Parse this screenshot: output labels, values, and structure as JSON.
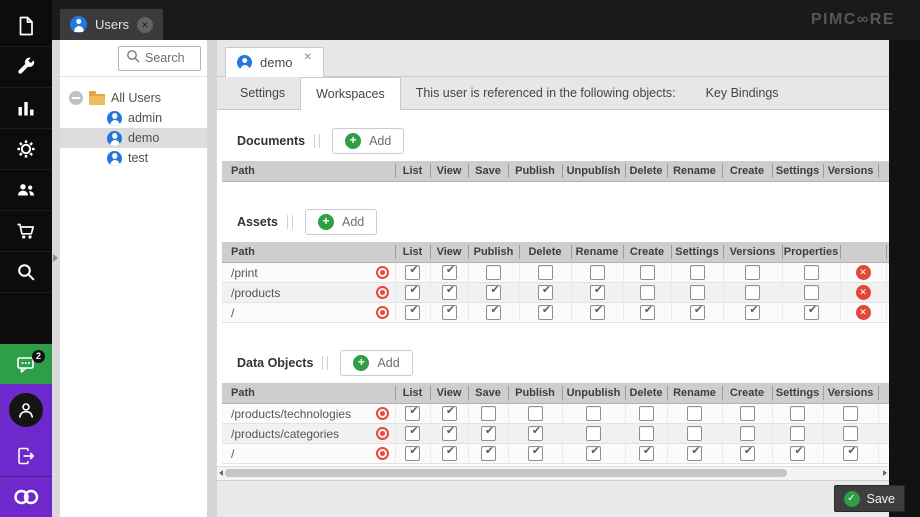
{
  "topbar": {
    "logo_text": "PIMC∞RE",
    "open_tab_label": "Users"
  },
  "sidebar": {
    "top_items": [
      {
        "name": "document-icon"
      },
      {
        "name": "wrench-icon"
      },
      {
        "name": "bar-chart-icon"
      },
      {
        "name": "gear-icon"
      },
      {
        "name": "users-icon"
      },
      {
        "name": "cart-icon"
      },
      {
        "name": "search-icon"
      }
    ],
    "chat_badge": "2"
  },
  "tree": {
    "search_placeholder": "Search",
    "root_label": "All Users",
    "items": [
      "admin",
      "demo",
      "test"
    ],
    "selected": "demo"
  },
  "editor": {
    "tab_label": "demo",
    "nav_tabs": [
      {
        "label": "Settings",
        "active": false
      },
      {
        "label": "Workspaces",
        "active": true
      },
      {
        "label": "This user is referenced in the following objects:",
        "active": false
      },
      {
        "label": "Key Bindings",
        "active": false
      }
    ],
    "sections": [
      {
        "id": "documents",
        "title": "Documents",
        "add_label": "Add",
        "columns": [
          "Path",
          "List",
          "View",
          "Save",
          "Publish",
          "Unpublish",
          "Delete",
          "Rename",
          "Create",
          "Settings",
          "Versions"
        ],
        "has_delete_column": false,
        "rows": []
      },
      {
        "id": "assets",
        "title": "Assets",
        "add_label": "Add",
        "columns": [
          "Path",
          "List",
          "View",
          "Publish",
          "Delete",
          "Rename",
          "Create",
          "Settings",
          "Versions",
          "Properties"
        ],
        "has_delete_column": true,
        "rows": [
          {
            "path": "/print",
            "checks": [
              true,
              true,
              false,
              false,
              false,
              false,
              false,
              false,
              false
            ]
          },
          {
            "path": "/products",
            "checks": [
              true,
              true,
              true,
              true,
              true,
              false,
              false,
              false,
              false
            ]
          },
          {
            "path": "/",
            "checks": [
              true,
              true,
              true,
              true,
              true,
              true,
              true,
              true,
              true
            ]
          }
        ]
      },
      {
        "id": "data-objects",
        "title": "Data Objects",
        "add_label": "Add",
        "columns": [
          "Path",
          "List",
          "View",
          "Save",
          "Publish",
          "Unpublish",
          "Delete",
          "Rename",
          "Create",
          "Settings",
          "Versions"
        ],
        "has_delete_column": false,
        "rows": [
          {
            "path": "/products/technologies",
            "checks": [
              true,
              true,
              false,
              false,
              false,
              false,
              false,
              false,
              false,
              false
            ]
          },
          {
            "path": "/products/categories",
            "checks": [
              true,
              true,
              true,
              true,
              false,
              false,
              false,
              false,
              false,
              false
            ]
          },
          {
            "path": "/",
            "checks": [
              true,
              true,
              true,
              true,
              true,
              true,
              true,
              true,
              true,
              true
            ]
          }
        ]
      }
    ],
    "save_label": "Save"
  },
  "colors": {
    "accent_green": "#2f9e44",
    "brand_purple": "#6f28cc",
    "user_blue": "#2577e0",
    "danger_red": "#e2453a",
    "selection_gray": "#dcdcdc"
  }
}
